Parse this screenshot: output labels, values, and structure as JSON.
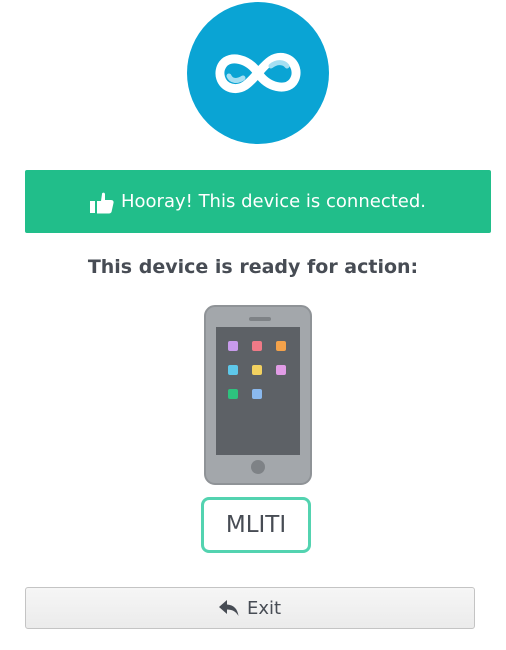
{
  "logo": {
    "icon": "infinity-logo-icon",
    "color": "#0aa4d4"
  },
  "banner": {
    "icon": "thumbs-up-icon",
    "text": "Hooray! This device is connected.",
    "color": "#21be8a"
  },
  "ready_title": "This device is ready for action:",
  "device": {
    "icon": "smartphone-icon",
    "name": "MLITI",
    "border_color": "#53d3b0"
  },
  "exit_button": {
    "icon": "reply-arrow-icon",
    "label": "Exit"
  }
}
